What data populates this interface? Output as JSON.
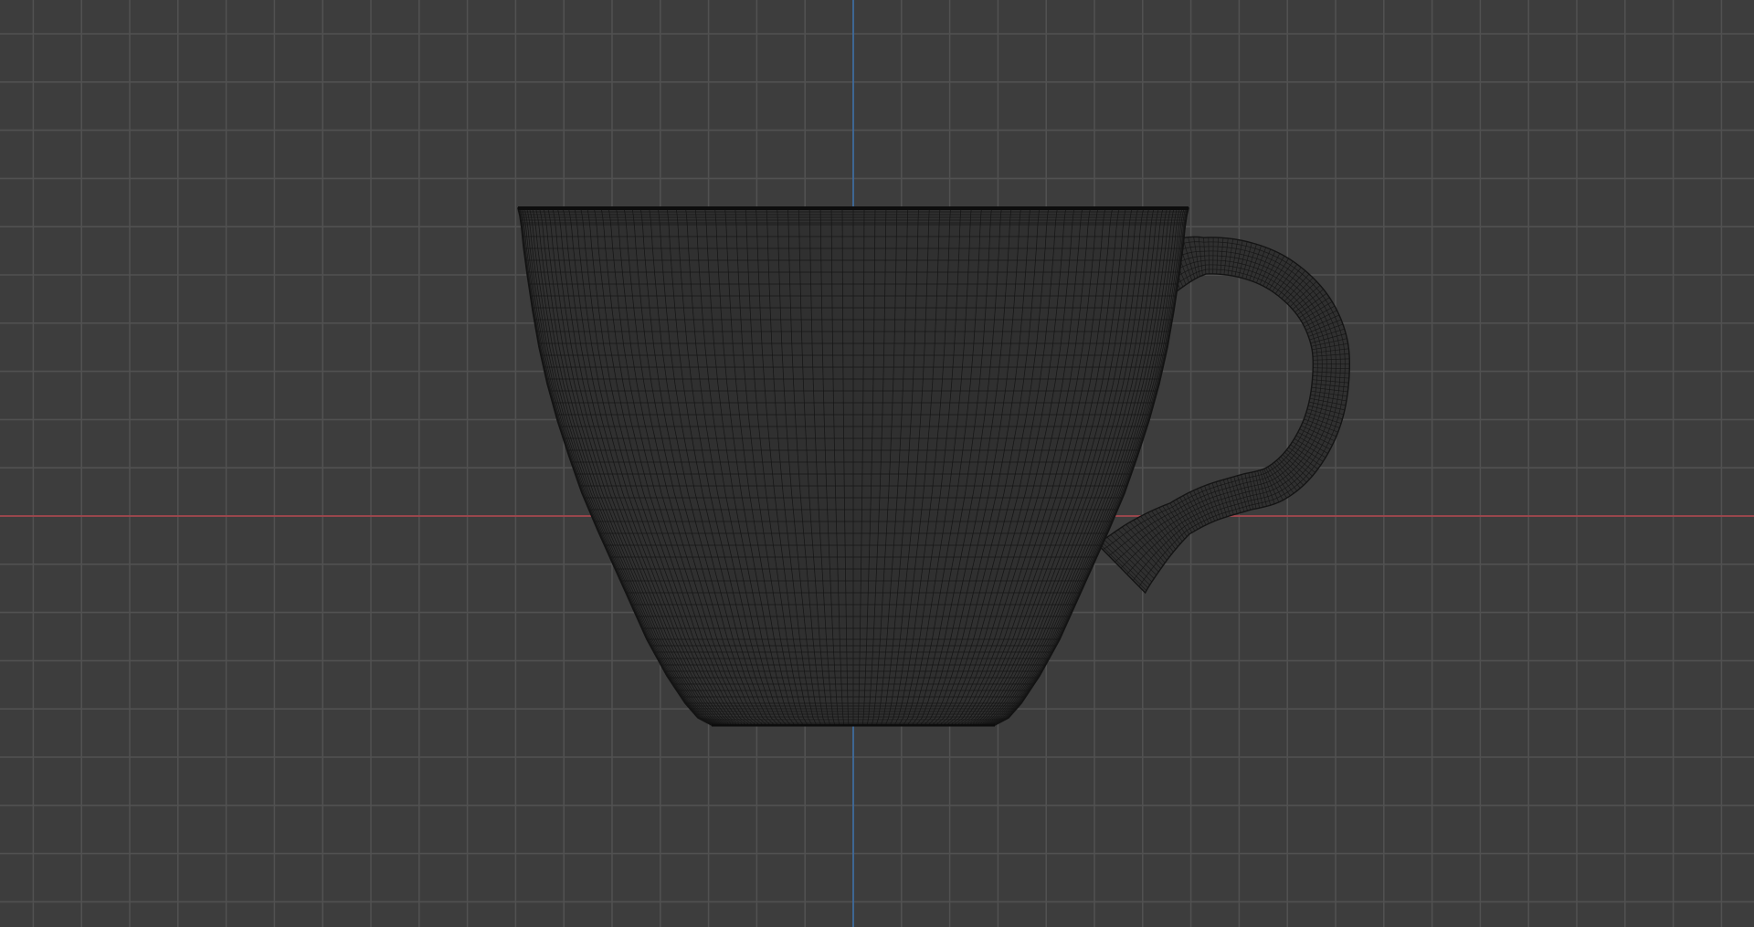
{
  "viewport": {
    "view": "front-orthographic",
    "shading": "wireframe",
    "grid_visible": true,
    "object": "coffee-cup-mesh"
  },
  "colors": {
    "background": "#3d3d3d",
    "grid_line": "#515151",
    "x_axis": "#a5464d",
    "z_axis": "#3e6a9c",
    "wire": "#141414",
    "mesh_fill": "#303030"
  }
}
